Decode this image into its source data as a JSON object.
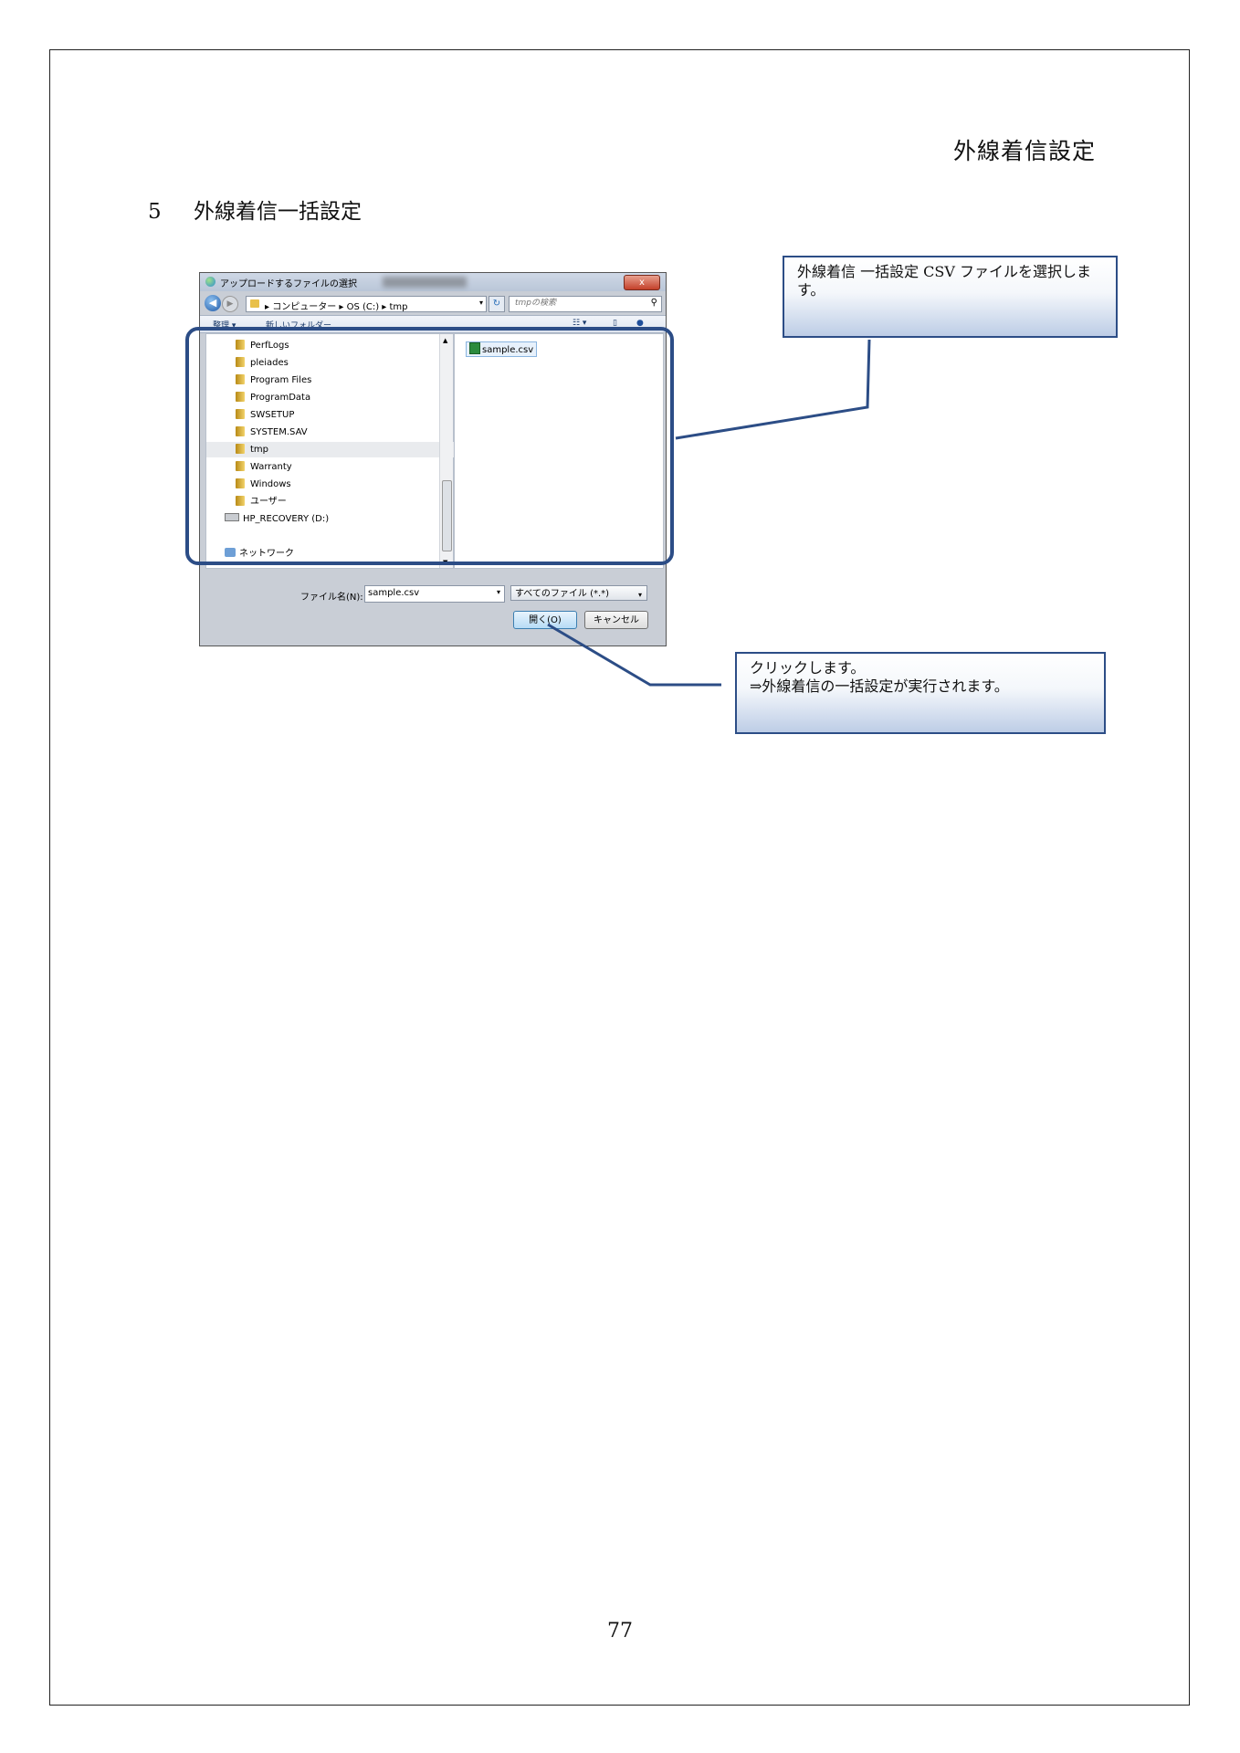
{
  "page": {
    "header_title": "外線着信設定",
    "section_number": "5",
    "section_title": "外線着信一括設定",
    "page_number": "77"
  },
  "dialog": {
    "title": "アップロードするファイルの選択",
    "close_label": "x",
    "address_path": "▸ コンピューター ▸ OS (C:) ▸ tmp",
    "search_placeholder": "tmpの検索",
    "toolbar_organize": "整理 ▾",
    "toolbar_new_folder": "新しいフォルダー",
    "toolbar_views": "☷ ▾",
    "nav_items": [
      {
        "label": "PerfLogs",
        "type": "folder",
        "selected": false
      },
      {
        "label": "pleiades",
        "type": "folder",
        "selected": false
      },
      {
        "label": "Program Files",
        "type": "folder",
        "selected": false
      },
      {
        "label": "ProgramData",
        "type": "folder",
        "selected": false
      },
      {
        "label": "SWSETUP",
        "type": "folder",
        "selected": false
      },
      {
        "label": "SYSTEM.SAV",
        "type": "folder",
        "selected": false
      },
      {
        "label": "tmp",
        "type": "folder",
        "selected": true
      },
      {
        "label": "Warranty",
        "type": "folder",
        "selected": false
      },
      {
        "label": "Windows",
        "type": "folder",
        "selected": false
      },
      {
        "label": "ユーザー",
        "type": "folder",
        "selected": false
      },
      {
        "label": "HP_RECOVERY (D:)",
        "type": "drive",
        "selected": false
      },
      {
        "label": "ネットワーク",
        "type": "network",
        "selected": false
      }
    ],
    "file_item": "sample.csv",
    "filename_label": "ファイル名(N):",
    "filename_value": "sample.csv",
    "filetype_value": "すべてのファイル (*.*)",
    "open_label": "開く(O)",
    "cancel_label": "キャンセル"
  },
  "callouts": {
    "select_csv": "外線着信 一括設定 CSV ファイルを選択します。",
    "click_line1": "クリックします。",
    "click_line2": "⇒外線着信の一括設定が実行されます。"
  },
  "colors": {
    "frame_blue": "#2c4d86"
  }
}
